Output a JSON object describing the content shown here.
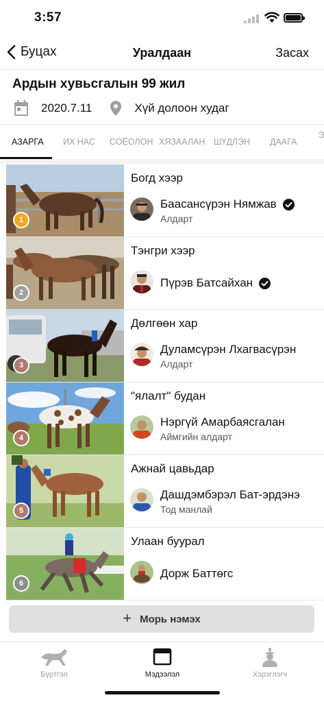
{
  "status_bar": {
    "time": "3:57"
  },
  "nav": {
    "back_label": "Буцах",
    "title": "Уралдаан",
    "edit_label": "Засах"
  },
  "race": {
    "title": "Ардын хувьсгалын 99 жил",
    "date": "2020.7.11",
    "location": "Хүй долоон худаг"
  },
  "tabs": [
    {
      "label": "АЗАРГА",
      "active": true
    },
    {
      "label": "ИХ НАС",
      "active": false
    },
    {
      "label": "СОЁОЛОН",
      "active": false
    },
    {
      "label": "ХЯЗААЛАН",
      "active": false
    },
    {
      "label": "ШҮДЛЭН",
      "active": false
    },
    {
      "label": "ДААГА",
      "active": false
    },
    {
      "label": "Э",
      "active": false
    }
  ],
  "horses": [
    {
      "rank": "1",
      "name": "Богд хээр",
      "owner": "Баасансүрэн Нямжав",
      "owner_title": "Алдарт",
      "verified": true,
      "badge_color": "#f5a623"
    },
    {
      "rank": "2",
      "name": "Тэнгри хээр",
      "owner": "Пүрэв Батсайхан",
      "owner_title": "",
      "verified": true,
      "badge_color": "#a0a0a0"
    },
    {
      "rank": "3",
      "name": "Дөлгөөн хар",
      "owner": "Дуламсүрэн Лхагвасүрэн",
      "owner_title": "Алдарт",
      "verified": false,
      "badge_color": "#b07a6e"
    },
    {
      "rank": "4",
      "name": "\"ялалт\" будан",
      "owner": "Нэргүй Амарбаясгалан",
      "owner_title": "Аймгийн алдарт",
      "verified": false,
      "badge_color": "#b07a6e"
    },
    {
      "rank": "5",
      "name": "Ажнай цавьдар",
      "owner": "Дашдэмбэрэл Бат-эрдэнэ",
      "owner_title": "Тод манлай",
      "verified": false,
      "badge_color": "#b07a6e"
    },
    {
      "rank": "6",
      "name": "Улаан буурал",
      "owner": "Дорж Баттөгс",
      "owner_title": "",
      "verified": false,
      "badge_color": "#8c8c8c"
    }
  ],
  "add_button": {
    "label": "Морь нэмэх"
  },
  "bottom_tabs": [
    {
      "label": "Бүртгэл",
      "icon": "horse-icon",
      "active": false
    },
    {
      "label": "Мэдээлэл",
      "icon": "browser-window-icon",
      "active": true
    },
    {
      "label": "Хэрэглэгч",
      "icon": "user-icon",
      "active": false
    }
  ],
  "colors": {
    "accent": "#111111",
    "inactive": "#9e9e9e",
    "divider": "#e6e6e6",
    "button_bg": "#e0e0e0"
  }
}
